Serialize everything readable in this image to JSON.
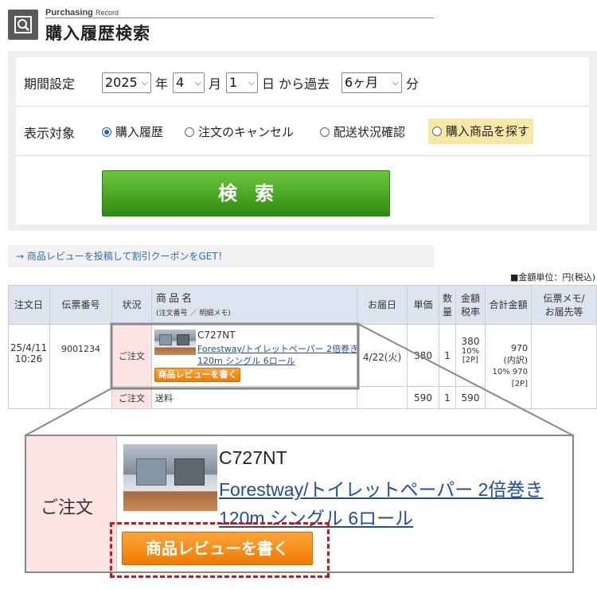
{
  "header": {
    "subtitle_main": "Purchasing",
    "subtitle_small": "Record",
    "title": "購入履歴検索",
    "icon": "search-icon"
  },
  "search_panel": {
    "period_label": "期間設定",
    "year_value": "2025",
    "year_unit": "年",
    "month_value": "4",
    "month_unit": "月",
    "day_value": "1",
    "day_unit": "日 から過去",
    "range_value": "6ヶ月",
    "range_unit": "分",
    "target_label": "表示対象",
    "radios": [
      {
        "label": "購入履歴",
        "selected": true
      },
      {
        "label": "注文のキャンセル",
        "selected": false
      },
      {
        "label": "配送状況確認",
        "selected": false
      },
      {
        "label": "購入商品を探す",
        "selected": false
      }
    ],
    "search_button": "検索"
  },
  "review_link": "→ 商品レビューを投稿して割引クーポンをGET！",
  "unit_note": "■金額単位：円(税込)",
  "table": {
    "headers": {
      "order_date": "注文日",
      "slip_no": "伝票番号",
      "status": "状況",
      "product_name": "商品名",
      "product_sub": "(注文番号 ／ 明細メモ)",
      "delivery_date": "お届日",
      "unit_price": "単価",
      "qty_1": "数",
      "qty_2": "量",
      "amount_1": "金額",
      "amount_2": "税率",
      "total": "合計金額",
      "memo_1": "伝票メモ/",
      "memo_2": "お届先等"
    },
    "order": {
      "date_1": "25/4/11",
      "date_2": "10:26",
      "slip_no": "9001234",
      "total_1": "970",
      "total_2": "(内訳)",
      "total_3": "10% 970",
      "total_4": "[2P]"
    },
    "rows": [
      {
        "status": "ご注文",
        "code": "C727NT",
        "name_1": "Forestway/トイレットペーパー 2倍巻き",
        "name_2": "120m シングル 6ロール",
        "review_button": "商品レビューを書く",
        "delivery": "4/22(火)",
        "unit_price": "380",
        "qty": "1",
        "amount": "380",
        "tax": "10%",
        "points": "[2P]"
      },
      {
        "status": "ご注文",
        "name": "送料",
        "unit_price": "590",
        "qty": "1",
        "amount": "590"
      }
    ]
  },
  "zoom": {
    "status": "ご注文",
    "code": "C727NT",
    "name_1": "Forestway/トイレットペーパー 2倍巻き",
    "name_2": "120m シングル 6ロール",
    "review_button": "商品レビューを書く"
  },
  "colors": {
    "accent_green": "#3a9a1a",
    "review_orange": "#f07a00",
    "link_blue": "#1f4fa3",
    "highlight_yellow": "#f5e9a6",
    "status_pink": "#fde4e4",
    "dash_red": "#dd1111"
  }
}
